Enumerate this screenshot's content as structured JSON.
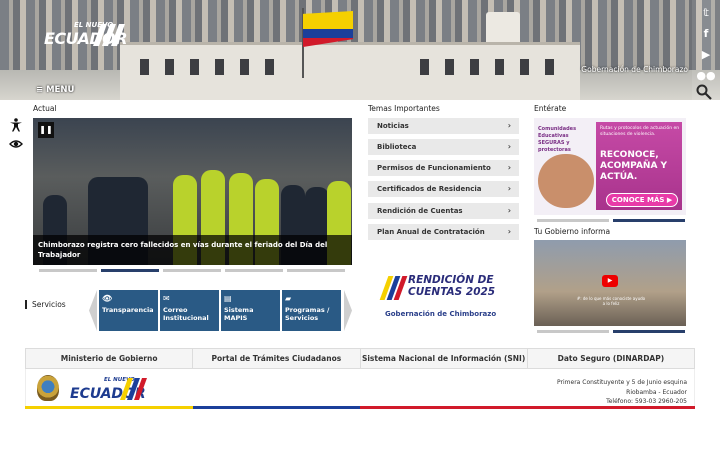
{
  "header": {
    "logo_small": "EL NUEVO",
    "logo_main": "ECUADOR",
    "gov_name": "Gobernación de Chimborazo",
    "menu_label": "≡ MENU"
  },
  "social": [
    {
      "name": "twitter",
      "glyph": "𝕥"
    },
    {
      "name": "facebook",
      "glyph": "f"
    },
    {
      "name": "youtube",
      "glyph": "▶"
    },
    {
      "name": "flickr",
      "glyph": "●●"
    }
  ],
  "labels": {
    "actual": "Actual",
    "temas": "Temas Importantes",
    "enterate": "Entérate",
    "tu_gobierno": "Tu Gobierno informa",
    "servicios": "Servicios"
  },
  "slider": {
    "caption": "Chimborazo registra cero fallecidos en vías durante el feriado del Día del Trabajador",
    "pause_glyph": "❚❚"
  },
  "temas": [
    "Noticias",
    "Biblioteca",
    "Permisos de Funcionamiento",
    "Certificados de Residencia",
    "Rendición de Cuentas",
    "Plan Anual de Contratación"
  ],
  "enterate": {
    "band": "Comunidades Educativas SEGURAS y protectoras",
    "top_text": "Rutas y protocolos de actuación en situaciones de violencia.",
    "headline": "RECONOCE, ACOMPAÑA Y ACTÚA.",
    "button": "CONOCE MÁS ▶"
  },
  "video": {
    "subtitle": "#: de lo que más conociste ayudo a lo feliz"
  },
  "rendicion": {
    "line1": "RENDICIÓN DE",
    "line2": "CUENTAS 2025",
    "org": "Gobernación de Chimborazo"
  },
  "services": [
    {
      "icon": "eye-icon",
      "glyph": "👁",
      "label": "Transparencia"
    },
    {
      "icon": "mail-icon",
      "glyph": "✉",
      "label": "Correo Institucional"
    },
    {
      "icon": "book-icon",
      "glyph": "▤",
      "label": "Sistema MAPIS"
    },
    {
      "icon": "folder-icon",
      "glyph": "▰",
      "label": "Programas / Servicios"
    }
  ],
  "links": [
    "Ministerio de Gobierno",
    "Portal de Trámites Ciudadanos",
    "Sistema Nacional de Información (SNI)",
    "Dato Seguro (DINARDAP)"
  ],
  "footer": {
    "address_line1": "Primera Constituyente y 5 de Junio esquina",
    "address_line2": "Riobamba - Ecuador",
    "phone": "Teléfono: 593-03 2960-205",
    "logo_small": "EL NUEVO",
    "logo_main": "ECUADOR"
  },
  "colors": {
    "flag_yellow": "#f5d000",
    "flag_blue": "#1b3f9a",
    "flag_red": "#d11a2a",
    "service_blue": "#2a5a85",
    "pink": "#c64aa6"
  }
}
